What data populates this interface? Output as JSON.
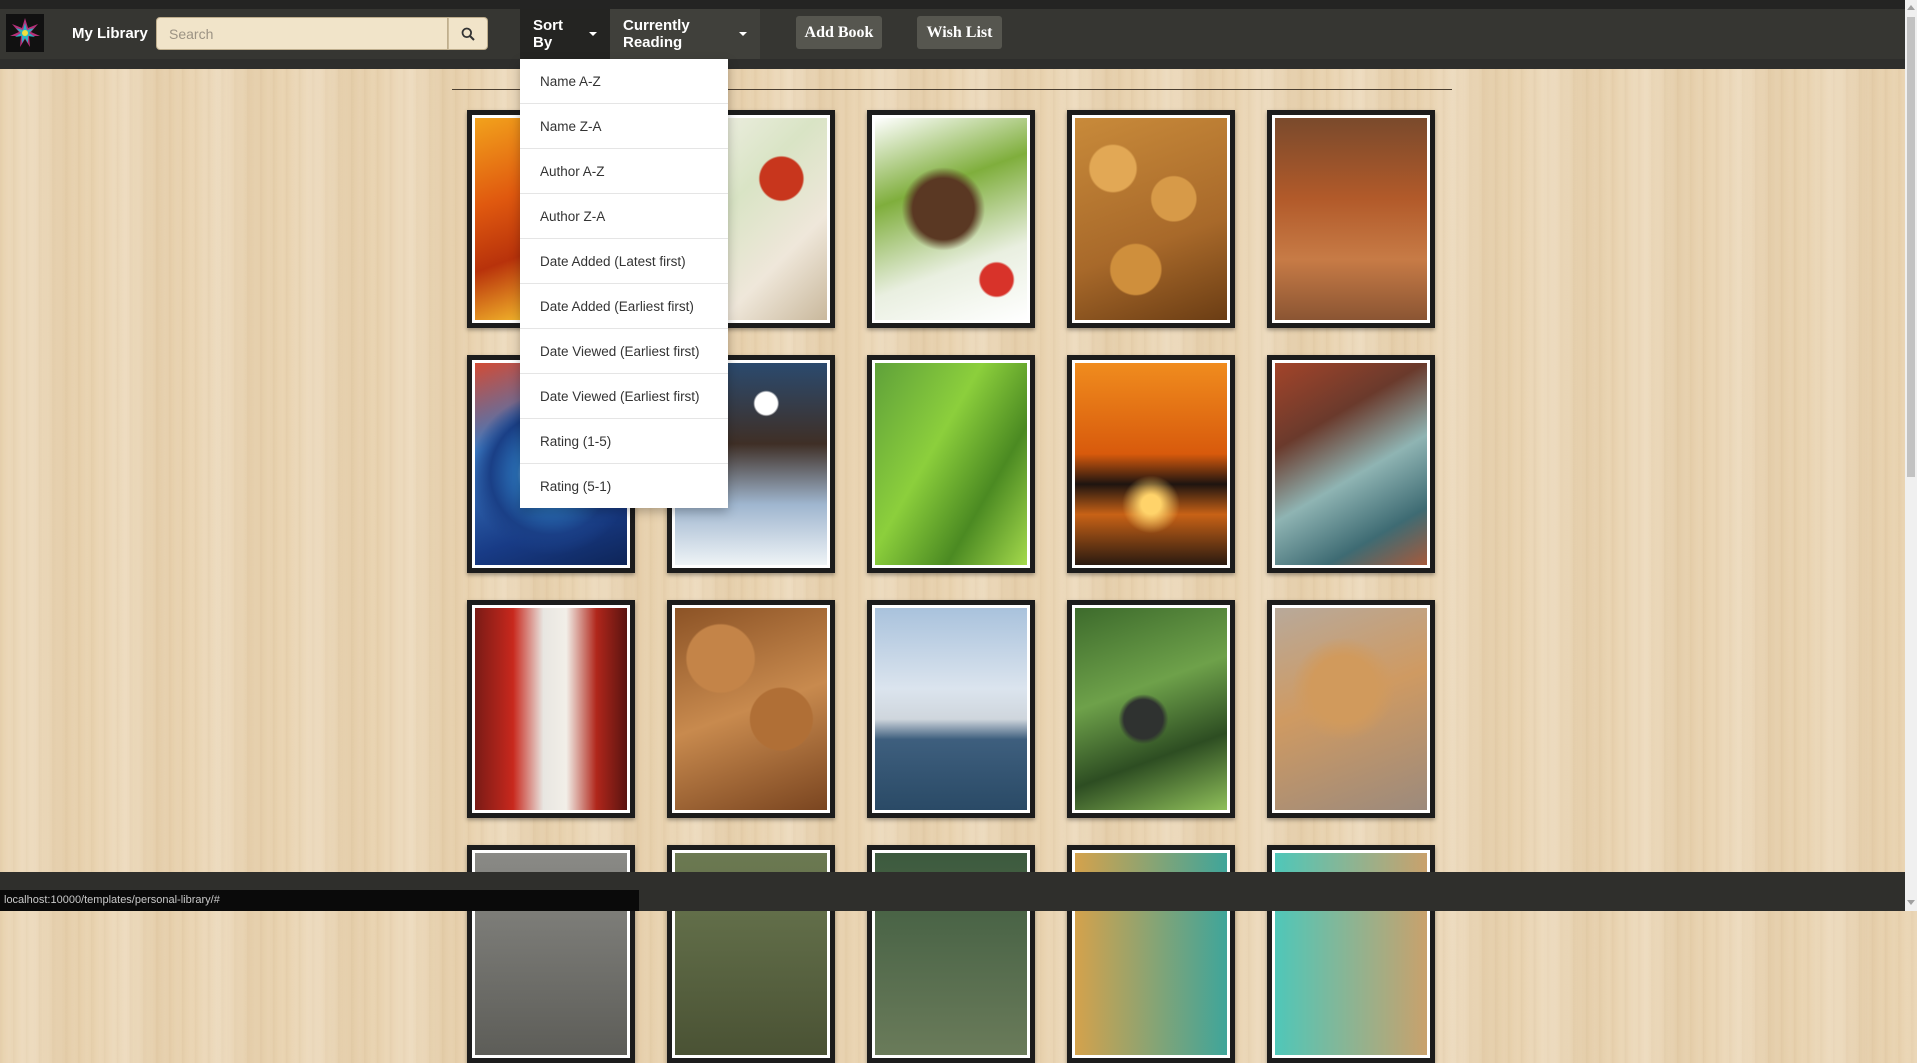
{
  "navbar": {
    "brand": "My Library",
    "search_placeholder": "Search",
    "sort_by_label": "Sort By",
    "currently_reading_label": "Currently Reading",
    "add_book_label": "Add Book",
    "wish_list_label": "Wish List"
  },
  "sort_menu": {
    "items": [
      "Name A-Z",
      "Name Z-A",
      "Author A-Z",
      "Author Z-A",
      "Date Added (Latest first)",
      "Date Added (Earliest first)",
      "Date Viewed (Earliest first)",
      "Date Viewed (Earliest first)",
      "Rating (1-5)",
      "Rating (5-1)"
    ]
  },
  "books": [
    {
      "cover": "autumn-leaves-fire"
    },
    {
      "cover": "spring-rolls-plate"
    },
    {
      "cover": "beef-salad"
    },
    {
      "cover": "nuts-pile"
    },
    {
      "cover": "autumn-tree-path"
    },
    {
      "cover": "blue-water-drop"
    },
    {
      "cover": "tree-silhouette-sky"
    },
    {
      "cover": "green-grass-blade"
    },
    {
      "cover": "orange-sunset-sea"
    },
    {
      "cover": "rocky-coastline-waves"
    },
    {
      "cover": "temple-woman-incense"
    },
    {
      "cover": "bread-loaves"
    },
    {
      "cover": "sydney-opera-house"
    },
    {
      "cover": "gorilla-forest"
    },
    {
      "cover": "golden-puppy"
    },
    {
      "cover": "partial-cover-1"
    },
    {
      "cover": "partial-cover-2"
    },
    {
      "cover": "partial-cover-3"
    },
    {
      "cover": "partial-cover-4"
    },
    {
      "cover": "partial-cover-5"
    }
  ],
  "status_bar": {
    "url": "localhost:10000/templates/personal-library/#"
  },
  "colors": {
    "navbar": "#363632",
    "sort_active": "#242422",
    "search_bg": "#f1e4c9",
    "button_bg": "#56564f",
    "page_bg": "#e9d3b0"
  }
}
